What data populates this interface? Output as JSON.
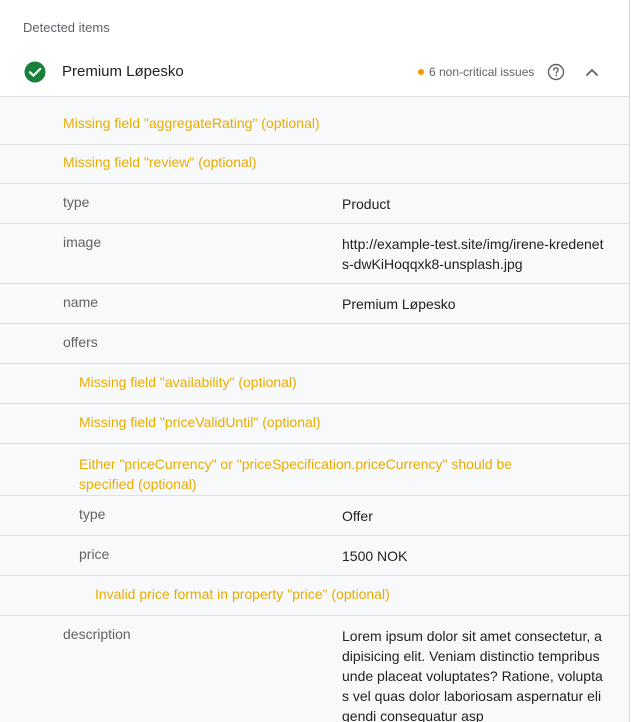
{
  "section_title": "Detected items",
  "item": {
    "name": "Premium Løpesko",
    "issues": "6 non-critical issues"
  },
  "rows": {
    "missing_aggregate": "Missing field \"aggregateRating\" (optional)",
    "missing_review": "Missing field \"review\" (optional)",
    "type_label": "type",
    "type_value": "Product",
    "image_label": "image",
    "image_value": "http://example-test.site/img/irene-kredenets-dwKiHoqqxk8-unsplash.jpg",
    "name_label": "name",
    "name_value": "Premium Løpesko",
    "offers_label": "offers",
    "missing_availability": "Missing field \"availability\" (optional)",
    "missing_price_valid": "Missing field \"priceValidUntil\" (optional)",
    "either_currency": "Either \"priceCurrency\" or \"priceSpecification.priceCurrency\" should be specified (optional)",
    "offer_type_label": "type",
    "offer_type_value": "Offer",
    "price_label": "price",
    "price_value": "1500 NOK",
    "invalid_price": "Invalid price format in property \"price\" (optional)",
    "description_label": "description",
    "description_value": "Lorem ipsum dolor sit amet consectetur, adipisicing elit. Veniam distinctio tempribus unde placeat voluptates? Ratione, voluptas vel quas dolor laboriosam aspernatur eligendi consequatur asp"
  },
  "colors": {
    "warning": "#e8ac00",
    "success": "#188038",
    "issue_dot": "#f29900"
  }
}
